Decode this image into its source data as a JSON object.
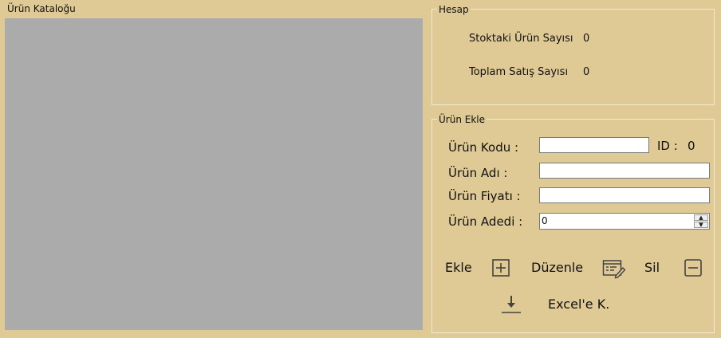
{
  "catalog": {
    "title": "Ürün Kataloğu"
  },
  "hesap": {
    "title": "Hesap",
    "stock_label": "Stoktaki Ürün Sayısı",
    "stock_value": "0",
    "sales_label": "Toplam Satış Sayısı",
    "sales_value": "0"
  },
  "form": {
    "title": "Ürün Ekle",
    "code_label": "Ürün Kodu :",
    "code_value": "",
    "id_label": "ID :",
    "id_value": "0",
    "name_label": "Ürün Adı :",
    "name_value": "",
    "price_label": "Ürün Fiyatı :",
    "price_value": "",
    "qty_label": "Ürün Adedi :",
    "qty_value": "0"
  },
  "actions": {
    "add_label": "Ekle",
    "edit_label": "Düzenle",
    "delete_label": "Sil",
    "export_label": "Excel'e K."
  },
  "icons": {
    "add": "plus-square-icon",
    "edit": "edit-list-icon",
    "delete": "minus-square-icon",
    "export": "download-icon"
  }
}
